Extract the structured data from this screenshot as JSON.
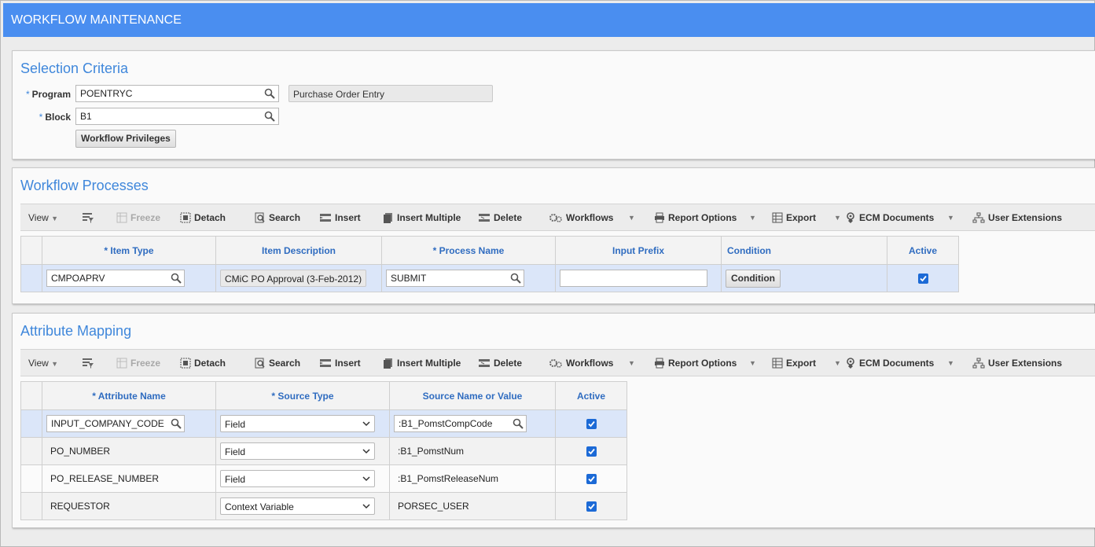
{
  "app": {
    "title": "WORKFLOW MAINTENANCE"
  },
  "selection": {
    "title": "Selection Criteria",
    "program_label": "Program",
    "program_value": "POENTRYC",
    "program_desc": "Purchase Order Entry",
    "block_label": "Block",
    "block_value": "B1",
    "privileges_button": "Workflow Privileges",
    "required_mark": "*"
  },
  "toolbar": {
    "view": "View",
    "freeze": "Freeze",
    "detach": "Detach",
    "search": "Search",
    "insert": "Insert",
    "insert_multiple": "Insert Multiple",
    "delete": "Delete",
    "workflows": "Workflows",
    "report_options": "Report Options",
    "export": "Export",
    "ecm_documents": "ECM Documents",
    "user_extensions": "User Extensions"
  },
  "processes": {
    "title": "Workflow Processes",
    "headers": [
      "* Item Type",
      "Item Description",
      "* Process Name",
      "Input Prefix",
      "Condition",
      "Active"
    ],
    "rows": [
      {
        "item_type": "CMPOAPRV",
        "item_description": "CMiC PO Approval (3-Feb-2012)",
        "process_name": "SUBMIT",
        "input_prefix": "",
        "condition_button": "Condition",
        "active": true
      }
    ]
  },
  "mapping": {
    "title": "Attribute Mapping",
    "headers": [
      "* Attribute Name",
      "* Source Type",
      "Source Name or Value",
      "Active"
    ],
    "rows": [
      {
        "attribute_name": "INPUT_COMPANY_CODE",
        "source_type": "Field",
        "source_value": ":B1_PomstCompCode",
        "active": true
      },
      {
        "attribute_name": "PO_NUMBER",
        "source_type": "Field",
        "source_value": ":B1_PomstNum",
        "active": true
      },
      {
        "attribute_name": "PO_RELEASE_NUMBER",
        "source_type": "Field",
        "source_value": ":B1_PomstReleaseNum",
        "active": true
      },
      {
        "attribute_name": "REQUESTOR",
        "source_type": "Context Variable",
        "source_value": "PORSEC_USER",
        "active": true
      }
    ]
  },
  "colors": {
    "titlebar": "#4a8ef0",
    "section_title": "#3f87db",
    "header_text": "#2f6cc0",
    "selected_row": "#dbe6f9",
    "checkbox": "#1c6ad6"
  }
}
